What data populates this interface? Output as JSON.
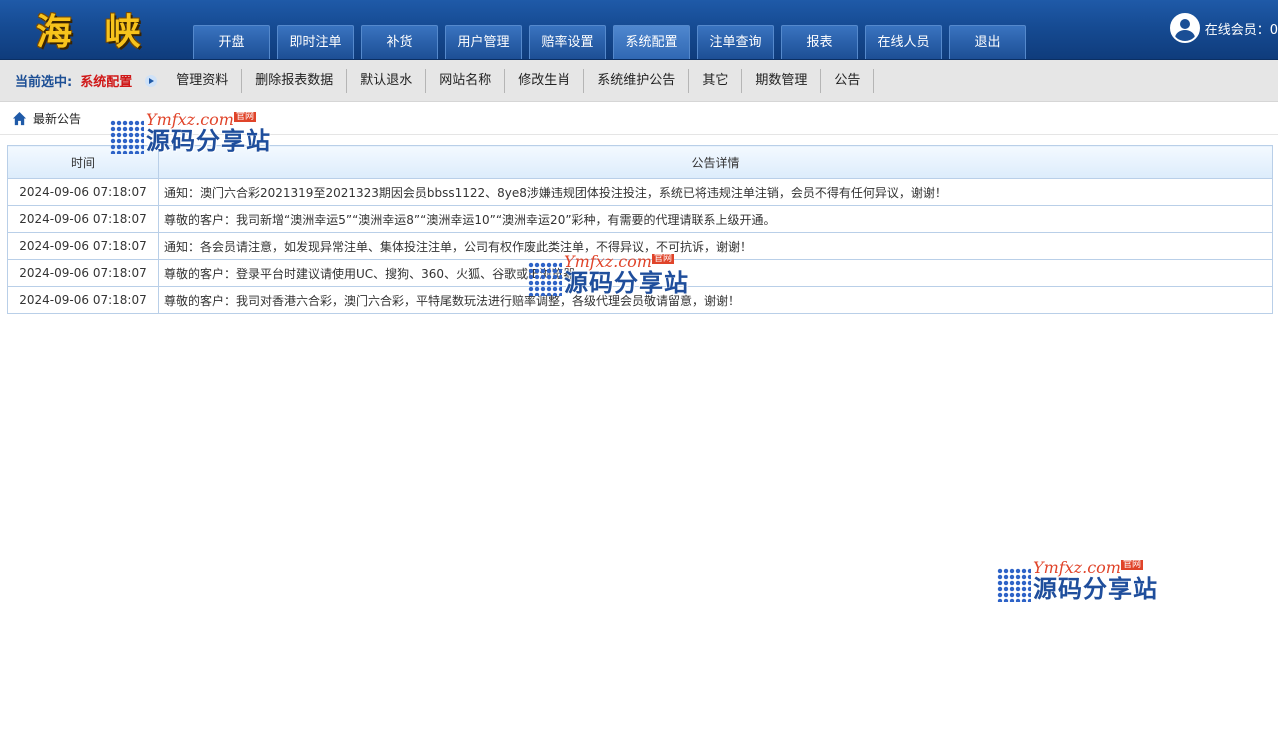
{
  "header": {
    "logo": "海 峡",
    "nav": [
      "开盘",
      "即时注单",
      "补货",
      "用户管理",
      "赔率设置",
      "系统配置",
      "注单查询",
      "报表",
      "在线人员",
      "退出"
    ],
    "online_label": "在线会员：0"
  },
  "subnav": {
    "current_label": "当前选中:",
    "current_value": "系统配置",
    "items": [
      "管理资料",
      "删除报表数据",
      "默认退水",
      "网站名称",
      "修改生肖",
      "系统维护公告",
      "其它",
      "期数管理",
      "公告"
    ]
  },
  "breadcrumb": {
    "title": "最新公告"
  },
  "table": {
    "headers": [
      "时间",
      "公告详情"
    ],
    "rows": [
      {
        "time": "2024-09-06 07:18:07",
        "detail": "通知：澳门六合彩2021319至2021323期因会员bbss1122、8ye8涉嫌违规团体投注投注，系统已将违规注单注销，会员不得有任何异议，谢谢！"
      },
      {
        "time": "2024-09-06 07:18:07",
        "detail": "尊敬的客户：我司新增“澳洲幸运5”“澳洲幸运8”“澳洲幸运10”“澳洲幸运20”彩种，有需要的代理请联系上级开通。"
      },
      {
        "time": "2024-09-06 07:18:07",
        "detail": "通知：各会员请注意，如发现异常注单、集体投注注单，公司有权作废此类注单，不得异议，不可抗诉，谢谢！"
      },
      {
        "time": "2024-09-06 07:18:07",
        "detail": "尊敬的客户：登录平台时建议请使用UC、搜狗、360、火狐、谷歌或IE浏览器"
      },
      {
        "time": "2024-09-06 07:18:07",
        "detail": "尊敬的客户：我司对香港六合彩，澳门六合彩，平特尾数玩法进行赔率调整，各级代理会员敬请留意，谢谢！"
      }
    ]
  },
  "watermark": {
    "url": "Ymfxz.com",
    "badge": "官网",
    "name": "源码分享站"
  }
}
